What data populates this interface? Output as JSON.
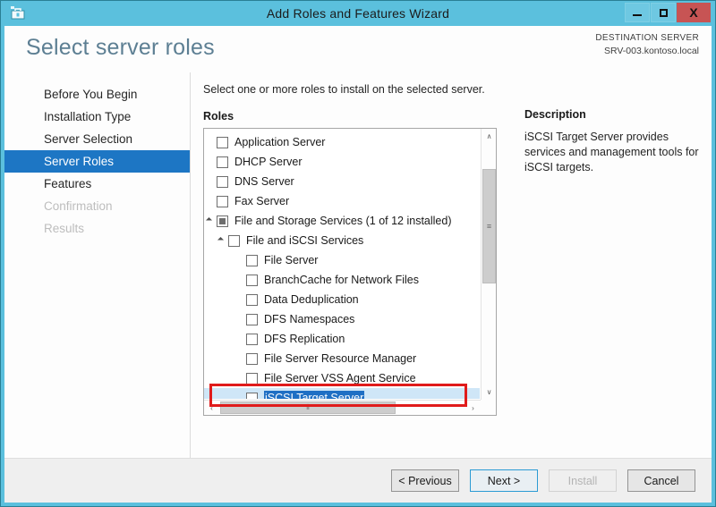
{
  "window": {
    "title": "Add Roles and Features Wizard",
    "icon": "wizard-toolbox-icon",
    "controls": {
      "minimize": "–",
      "maximize": "□",
      "close": "X"
    },
    "frame_color": "#5bc0dd"
  },
  "header": {
    "page_title": "Select server roles",
    "destination_label": "DESTINATION SERVER",
    "destination_value": "SRV-003.kontoso.local"
  },
  "nav": {
    "items": [
      {
        "label": "Before You Begin",
        "state": "normal"
      },
      {
        "label": "Installation Type",
        "state": "normal"
      },
      {
        "label": "Server Selection",
        "state": "normal"
      },
      {
        "label": "Server Roles",
        "state": "active"
      },
      {
        "label": "Features",
        "state": "normal"
      },
      {
        "label": "Confirmation",
        "state": "disabled"
      },
      {
        "label": "Results",
        "state": "disabled"
      }
    ],
    "active_color": "#1d76c4"
  },
  "main": {
    "instruction": "Select one or more roles to install on the selected server.",
    "roles_label": "Roles",
    "tree": [
      {
        "label": "Application Server",
        "level": 0,
        "checkbox": "unchecked",
        "expander": "none",
        "selected": false
      },
      {
        "label": "DHCP Server",
        "level": 0,
        "checkbox": "unchecked",
        "expander": "none",
        "selected": false
      },
      {
        "label": "DNS Server",
        "level": 0,
        "checkbox": "unchecked",
        "expander": "none",
        "selected": false
      },
      {
        "label": "Fax Server",
        "level": 0,
        "checkbox": "unchecked",
        "expander": "none",
        "selected": false
      },
      {
        "label": "File and Storage Services (1 of 12 installed)",
        "level": 0,
        "checkbox": "partial",
        "expander": "expanded",
        "selected": false
      },
      {
        "label": "File and iSCSI Services",
        "level": 1,
        "checkbox": "unchecked",
        "expander": "expanded",
        "selected": false
      },
      {
        "label": "File Server",
        "level": 2,
        "checkbox": "unchecked",
        "expander": "none",
        "selected": false
      },
      {
        "label": "BranchCache for Network Files",
        "level": 2,
        "checkbox": "unchecked",
        "expander": "none",
        "selected": false
      },
      {
        "label": "Data Deduplication",
        "level": 2,
        "checkbox": "unchecked",
        "expander": "none",
        "selected": false
      },
      {
        "label": "DFS Namespaces",
        "level": 2,
        "checkbox": "unchecked",
        "expander": "none",
        "selected": false
      },
      {
        "label": "DFS Replication",
        "level": 2,
        "checkbox": "unchecked",
        "expander": "none",
        "selected": false
      },
      {
        "label": "File Server Resource Manager",
        "level": 2,
        "checkbox": "unchecked",
        "expander": "none",
        "selected": false
      },
      {
        "label": "File Server VSS Agent Service",
        "level": 2,
        "checkbox": "unchecked",
        "expander": "none",
        "selected": false
      },
      {
        "label": "iSCSI Target Server",
        "level": 2,
        "checkbox": "unchecked",
        "expander": "none",
        "selected": true
      }
    ],
    "annotation": {
      "target": "iSCSI Target Server",
      "color": "#e01b1b"
    },
    "scroll": {
      "vertical_up": "∧",
      "vertical_down": "∨",
      "horizontal_left": "‹",
      "horizontal_right": "›",
      "grip": "≡",
      "h_grip": "⦀"
    }
  },
  "description": {
    "title": "Description",
    "text": "iSCSI Target Server provides services and management tools for iSCSI targets."
  },
  "footer": {
    "buttons": [
      {
        "label": "< Previous",
        "state": "normal"
      },
      {
        "label": "Next >",
        "state": "focused"
      },
      {
        "label": "Install",
        "state": "disabled"
      },
      {
        "label": "Cancel",
        "state": "normal"
      }
    ]
  }
}
